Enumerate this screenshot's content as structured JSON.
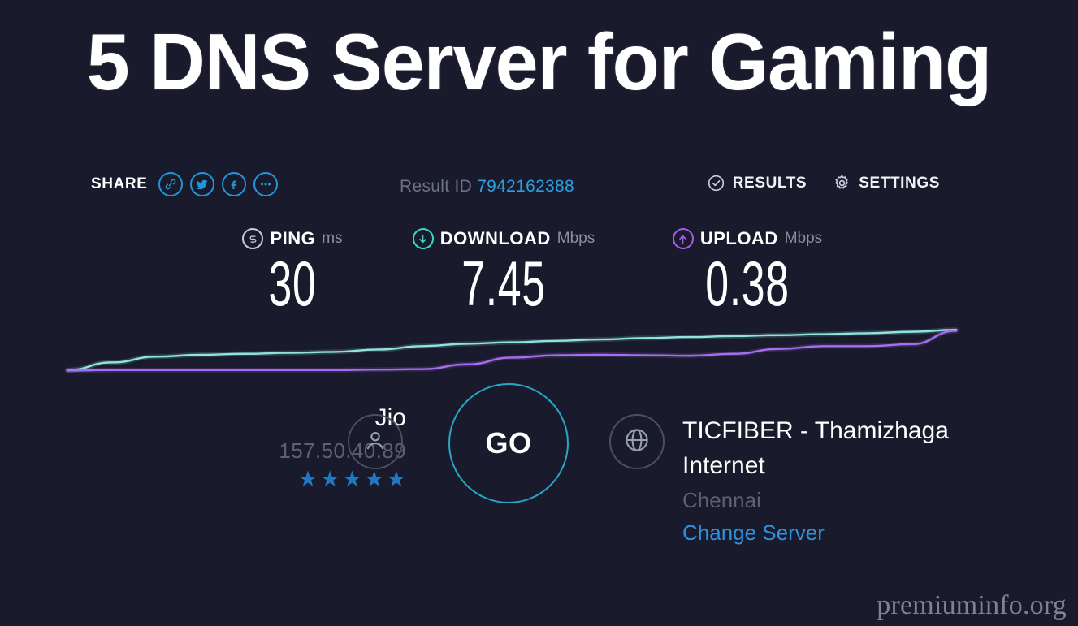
{
  "page": {
    "title": "5 DNS Server for Gaming",
    "background_color": "#191a2b",
    "watermark": "premiuminfo.org"
  },
  "topbar": {
    "share_label": "SHARE",
    "share_icons": [
      {
        "name": "link-icon",
        "label": "Copy link"
      },
      {
        "name": "twitter-icon",
        "label": "Twitter"
      },
      {
        "name": "facebook-icon",
        "label": "Facebook"
      },
      {
        "name": "more-icon",
        "label": "More"
      }
    ],
    "result_id_label": "Result ID",
    "result_id_value": "7942162388",
    "results_label": "RESULTS",
    "settings_label": "SETTINGS"
  },
  "metrics": {
    "ping": {
      "name": "PING",
      "unit": "ms",
      "value": "30",
      "color": "#c9ccd8"
    },
    "download": {
      "name": "DOWNLOAD",
      "unit": "Mbps",
      "value": "7.45",
      "color": "#3ad6c4"
    },
    "upload": {
      "name": "UPLOAD",
      "unit": "Mbps",
      "value": "0.38",
      "color": "#a45cf0"
    }
  },
  "chart_data": {
    "type": "line",
    "title": "",
    "xlabel": "",
    "ylabel": "",
    "grid": false,
    "legend": "none",
    "x": [
      0,
      5,
      10,
      15,
      20,
      25,
      30,
      35,
      40,
      45,
      50,
      55,
      60,
      65,
      70,
      75,
      80,
      85,
      90,
      95,
      100
    ],
    "series": [
      {
        "name": "download",
        "color": "#8fe3e0",
        "values": [
          2,
          18,
          30,
          34,
          36,
          38,
          40,
          45,
          52,
          57,
          60,
          63,
          66,
          69,
          71,
          73,
          75,
          77,
          79,
          82,
          86
        ]
      },
      {
        "name": "upload",
        "color": "#a86ef0",
        "values": [
          1,
          2,
          2,
          2,
          2,
          2,
          2,
          3,
          4,
          14,
          28,
          33,
          34,
          33,
          32,
          36,
          46,
          52,
          52,
          56,
          84
        ]
      }
    ],
    "ylim": [
      0,
      100
    ],
    "xlim": [
      0,
      100
    ]
  },
  "connection": {
    "isp_name": "Jio",
    "ip_address": "157.50.40.89",
    "rating_stars": 5,
    "star_glyph": "★",
    "star_color": "#1d79c4",
    "go_label": "GO",
    "server_name": "TICFIBER - Thamizhaga Internet",
    "server_city": "Chennai",
    "change_server_label": "Change Server"
  }
}
